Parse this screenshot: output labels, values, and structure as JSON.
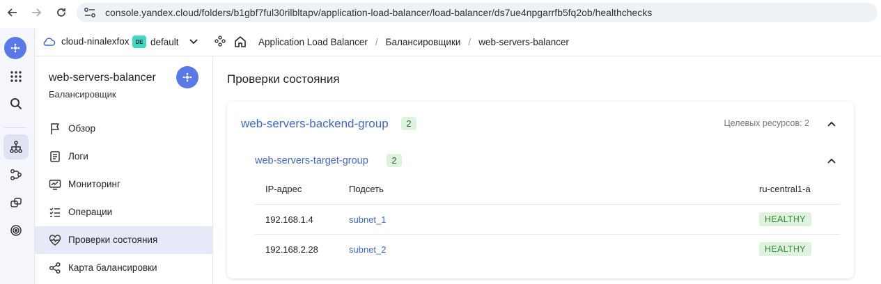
{
  "browser": {
    "url": "console.yandex.cloud/folders/b1gbf7ful30rilbltapv/application-load-balancer/load-balancer/ds7ue4npgarrfb5fq2ob/healthchecks"
  },
  "header": {
    "cloud": "cloud-ninalexfox",
    "folder_badge": "DE",
    "folder": "default",
    "breadcrumbs": [
      "Application Load Balancer",
      "Балансировщики",
      "web-servers-balancer"
    ],
    "separator": "/"
  },
  "sidebar": {
    "title": "web-servers-balancer",
    "subtitle": "Балансировщик",
    "items": [
      {
        "label": "Обзор",
        "icon": "flag-icon"
      },
      {
        "label": "Логи",
        "icon": "log-icon"
      },
      {
        "label": "Мониторинг",
        "icon": "monitor-icon"
      },
      {
        "label": "Операции",
        "icon": "operations-icon"
      },
      {
        "label": "Проверки состояния",
        "icon": "heartbeat-icon",
        "active": true
      },
      {
        "label": "Карта балансировки",
        "icon": "map-icon"
      }
    ]
  },
  "main": {
    "title": "Проверки состояния",
    "backend_group": {
      "name": "web-servers-backend-group",
      "count": "2",
      "targets_label": "Целевых ресурсов: 2"
    },
    "target_group": {
      "name": "web-servers-target-group",
      "count": "2",
      "columns": [
        "IP-адрес",
        "Подсеть",
        "ru-central1-a"
      ],
      "rows": [
        {
          "ip": "192.168.1.4",
          "subnet": "subnet_1",
          "status": "HEALTHY"
        },
        {
          "ip": "192.168.2.28",
          "subnet": "subnet_2",
          "status": "HEALTHY"
        }
      ]
    }
  },
  "colors": {
    "accent": "#3f67cc",
    "logo": "#5a79e8",
    "healthy_bg": "#dff2df",
    "healthy_text": "#2f8a2f"
  }
}
